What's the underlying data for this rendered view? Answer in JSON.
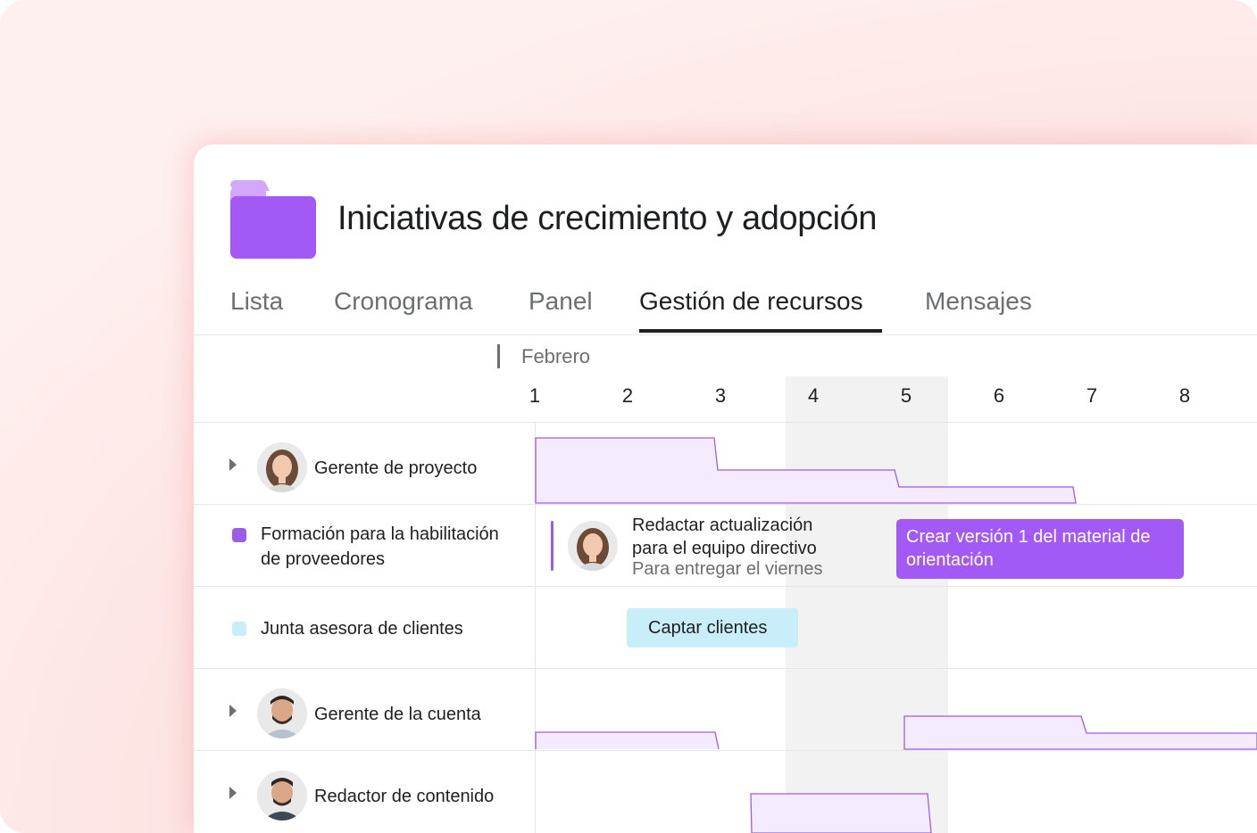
{
  "project": {
    "title": "Iniciativas de crecimiento y adopción",
    "folder_icon": "folder-icon",
    "folder_color": "#a259f5"
  },
  "tabs": [
    {
      "label": "Lista",
      "active": false
    },
    {
      "label": "Cronograma",
      "active": false
    },
    {
      "label": "Panel",
      "active": false
    },
    {
      "label": "Gestión de recursos",
      "active": true
    },
    {
      "label": "Mensajes",
      "active": false
    }
  ],
  "timeline": {
    "month": "Febrero",
    "days": [
      "1",
      "2",
      "3",
      "4",
      "5",
      "6",
      "7",
      "8"
    ],
    "highlighted_days": [
      "4",
      "5"
    ]
  },
  "rows": [
    {
      "type": "person",
      "label": "Gerente de proyecto",
      "icon": "caret-right-icon"
    },
    {
      "type": "project",
      "label_line1": "Formación para la habilitación",
      "label_line2": "de proveedores",
      "color": "#9b5de5"
    },
    {
      "type": "project",
      "label": "Junta asesora de clientes",
      "color": "#c7eef9"
    },
    {
      "type": "person",
      "label": "Gerente de la cuenta",
      "icon": "caret-right-icon"
    },
    {
      "type": "person",
      "label": "Redactor de contenido",
      "icon": "caret-right-icon"
    }
  ],
  "tasks": {
    "update_task": {
      "title_line1": "Redactar actualización",
      "title_line2": "para el equipo directivo",
      "subtitle": "Para entregar el viernes"
    },
    "purple_bar": {
      "line1": "Crear versión 1 del material de",
      "line2": "orientación",
      "color": "#a259f5"
    },
    "blue_bar": {
      "label": "Captar clientes",
      "color": "#c7eef9"
    }
  }
}
